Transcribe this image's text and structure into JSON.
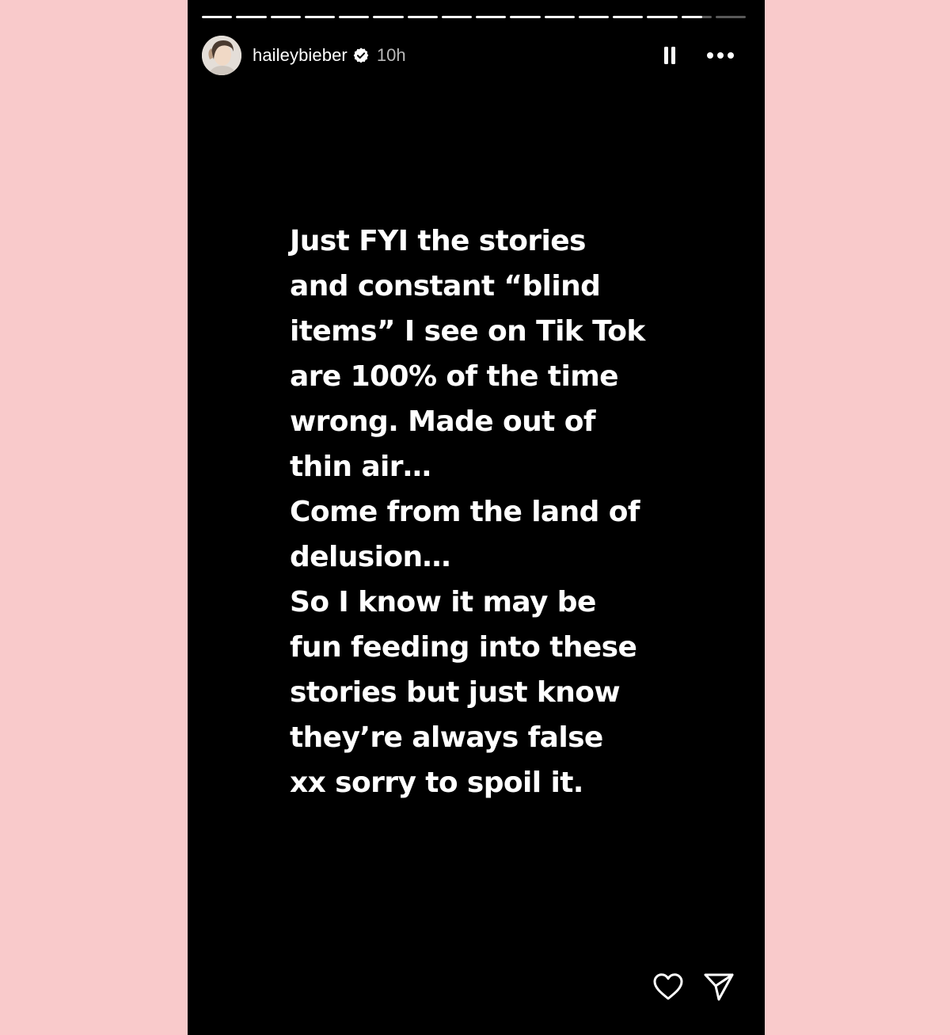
{
  "story": {
    "username": "haileybieber",
    "time_ago": "10h",
    "verified": true,
    "progress": {
      "segments_total": 16,
      "segments_completed": 14,
      "current_segment_fraction": 0.7
    },
    "message_lines": [
      "Just FYI the stories",
      "and constant “blind",
      "items” I see on Tik Tok",
      "are 100% of the time",
      "wrong. Made out of",
      "thin air…",
      "Come from the land of",
      "delusion…",
      "So I know it may be",
      "fun feeding into these",
      "stories but just know",
      "they’re always false",
      "xx sorry to spoil it."
    ],
    "icons": {
      "pause": "pause-icon",
      "more": "more-options-icon",
      "like": "heart-icon",
      "share": "send-icon",
      "verified": "verified-badge-icon"
    }
  },
  "colors": {
    "background": "#f9cacb",
    "story_bg": "#000000",
    "text": "#ffffff"
  }
}
